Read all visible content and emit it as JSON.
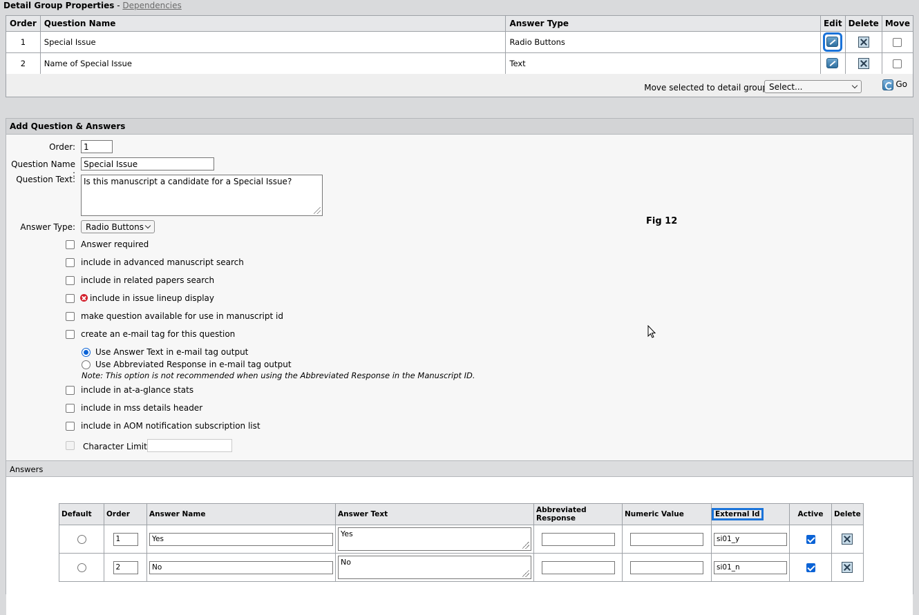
{
  "header": {
    "title": "Detail Group Properties",
    "separator": " - ",
    "dependencies_link": "Dependencies"
  },
  "questions_table": {
    "columns": [
      "Order",
      "Question Name",
      "Answer Type",
      "Edit",
      "Delete",
      "Move"
    ],
    "rows": [
      {
        "order": "1",
        "name": "Special Issue",
        "answer_type": "Radio Buttons"
      },
      {
        "order": "2",
        "name": "Name of Special Issue",
        "answer_type": "Text"
      }
    ],
    "move_label": "Move selected to detail group:",
    "move_select_value": "Select...",
    "go_label": "Go"
  },
  "add_panel": {
    "title": "Add Question & Answers",
    "order_label": "Order:",
    "order_value": "1",
    "question_name_label": "Question Name :",
    "question_name_value": "Special Issue",
    "question_text_label": "Question Text:",
    "question_text_value": "Is this manuscript a candidate for a Special Issue?",
    "answer_type_label": "Answer Type:",
    "answer_type_value": "Radio Buttons",
    "options": [
      {
        "label": "Answer required"
      },
      {
        "label": "include in advanced manuscript search"
      },
      {
        "label": "include in related papers search"
      },
      {
        "label": "include in issue lineup display"
      },
      {
        "label": "make question available for use in manuscript id"
      },
      {
        "label": "create an e-mail tag for this question"
      }
    ],
    "email_tag_radio_1": "Use Answer Text in e-mail tag output",
    "email_tag_radio_2": "Use Abbreviated Response in e-mail tag output",
    "note": "Note: This option is not recommended when using the Abbreviated Response in the Manuscript ID.",
    "options_2": [
      {
        "label": "include in at-a-glance stats"
      },
      {
        "label": "include in mss details header"
      },
      {
        "label": "include in AOM notification subscription list"
      }
    ],
    "char_limit_label": "Character Limit:"
  },
  "fig_label": "Fig 12",
  "answers": {
    "title": "Answers",
    "columns": [
      "Default",
      "Order",
      "Answer Name",
      "Answer Text",
      "Abbreviated Response",
      "Numeric Value",
      "External Id",
      "Active",
      "Delete"
    ],
    "rows": [
      {
        "order": "1",
        "name": "Yes",
        "text": "Yes",
        "abbr": "",
        "numeric": "",
        "external_id": "si01_y"
      },
      {
        "order": "2",
        "name": "No",
        "text": "No",
        "abbr": "",
        "numeric": "",
        "external_id": "si01_n"
      }
    ]
  }
}
